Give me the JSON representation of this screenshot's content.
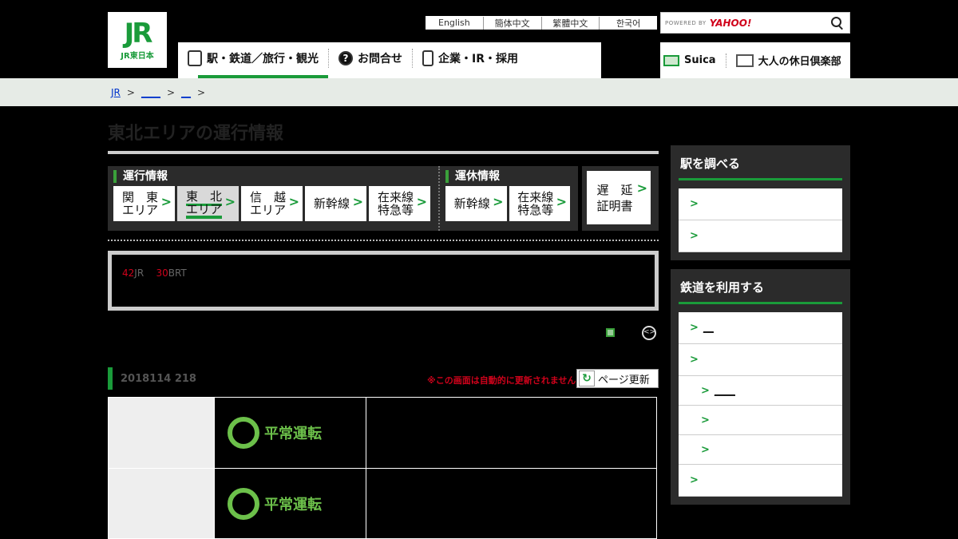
{
  "header": {
    "logo_text": "JR東日本",
    "logo_mark": "JR",
    "languages": [
      "English",
      "簡体中文",
      "繁體中文",
      "한국어"
    ],
    "search": {
      "powered_by": "POWERED BY",
      "provider": "YAHOO!",
      "placeholder": ""
    },
    "gnav": [
      {
        "label": "駅・鉄道／旅行・観光",
        "icon": "train-icon",
        "active": true
      },
      {
        "label": "お問合せ",
        "icon": "question-icon",
        "active": false
      },
      {
        "label": "企業・IR・採用",
        "icon": "building-icon",
        "active": false
      }
    ],
    "snav": [
      {
        "label": "Suica",
        "icon": "suica-card-icon"
      },
      {
        "label": "大人の休日倶楽部",
        "icon": "bag-icon"
      }
    ]
  },
  "breadcrumb": {
    "items": [
      "JR",
      "____",
      "__"
    ],
    "separator": ">"
  },
  "page": {
    "title": "東北エリアの運行情報",
    "operation_label": "運行情報",
    "suspension_label": "運休情報",
    "operation_tabs": [
      {
        "l1": "関　東",
        "l2": "エリア",
        "active": false
      },
      {
        "l1": "東　北",
        "l2": "エリア",
        "active": true
      },
      {
        "l1": "信　越",
        "l2": "エリア",
        "active": false
      },
      {
        "l1": "新幹線",
        "l2": "",
        "active": false
      },
      {
        "l1": "在来線",
        "l2": "特急等",
        "active": false
      }
    ],
    "suspension_tabs": [
      {
        "l1": "新幹線",
        "l2": ""
      },
      {
        "l1": "在来線",
        "l2": "特急等"
      }
    ],
    "delay_cert": {
      "l1": "遅　延",
      "l2": "証明書"
    },
    "notice": {
      "n1": "42",
      "t1": "JR",
      "n2": "30",
      "t2": "BRT"
    },
    "update": {
      "datetime": "2018114 218",
      "warning": "※この画面は自動的に更新されません",
      "button": "ページ更新"
    },
    "status_rows": [
      {
        "status": "平常運転"
      },
      {
        "status": "平常運転"
      }
    ]
  },
  "sidebar": {
    "station": {
      "title": "駅を調べる",
      "items": [
        "",
        ""
      ]
    },
    "railway": {
      "title": "鉄道を利用する",
      "items": [
        {
          "label": "__",
          "sub": false
        },
        {
          "label": "",
          "sub": false
        },
        {
          "label": "____",
          "sub": true
        },
        {
          "label": "",
          "sub": true
        },
        {
          "label": "",
          "sub": true
        },
        {
          "label": "",
          "sub": false
        }
      ]
    }
  },
  "colors": {
    "brand_green": "#1a9b3a",
    "status_green": "#6cc04a",
    "warning_red": "#d0021b"
  }
}
